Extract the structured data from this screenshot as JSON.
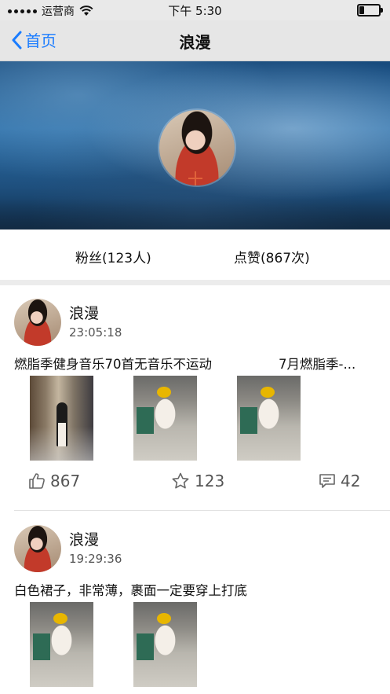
{
  "status_bar": {
    "carrier": "运营商",
    "time": "下午 5:30"
  },
  "nav": {
    "back_label": "首页",
    "title": "浪漫"
  },
  "stats": {
    "fans": "粉丝(123人)",
    "likes": "点赞(867次)"
  },
  "posts": [
    {
      "name": "浪漫",
      "time": "23:05:18",
      "text": "燃脂季健身音乐70首无音乐不运动",
      "text2": "7月燃脂季-...",
      "likes": "867",
      "favorites": "123",
      "comments": "42"
    },
    {
      "name": "浪漫",
      "time": "19:29:36",
      "text": "白色裙子，非常薄，裹面一定要穿上打底"
    }
  ],
  "icons": {
    "back": "chevron-left-icon",
    "wifi": "wifi-icon",
    "battery": "battery-icon",
    "like": "thumbs-up-icon",
    "favorite": "star-icon",
    "comment": "comment-icon",
    "add": "plus-icon"
  },
  "colors": {
    "accent": "#1a7cff",
    "plus": "#e0623a"
  }
}
